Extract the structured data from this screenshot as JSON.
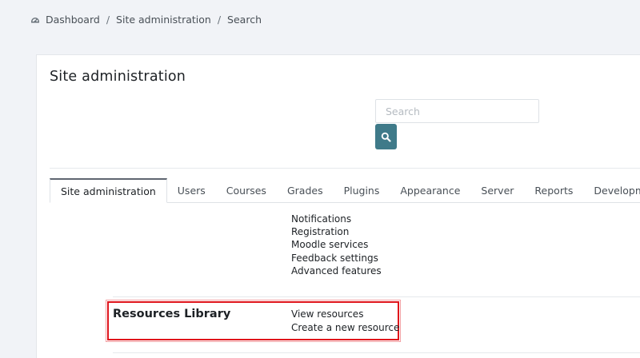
{
  "breadcrumb": {
    "items": [
      "Dashboard",
      "Site administration",
      "Search"
    ],
    "separator": "/"
  },
  "page": {
    "title": "Site administration"
  },
  "search": {
    "placeholder": "Search",
    "button_icon": "search-icon"
  },
  "tabs": [
    {
      "label": "Site administration",
      "active": true
    },
    {
      "label": "Users",
      "active": false
    },
    {
      "label": "Courses",
      "active": false
    },
    {
      "label": "Grades",
      "active": false
    },
    {
      "label": "Plugins",
      "active": false
    },
    {
      "label": "Appearance",
      "active": false
    },
    {
      "label": "Server",
      "active": false
    },
    {
      "label": "Reports",
      "active": false
    },
    {
      "label": "Development",
      "active": false
    }
  ],
  "general_links": [
    "Notifications",
    "Registration",
    "Moodle services",
    "Feedback settings",
    "Advanced features"
  ],
  "resources_section": {
    "heading": "Resources Library",
    "links": [
      "View resources",
      "Create a new resource"
    ]
  },
  "colors": {
    "accent": "#3f7a89",
    "highlight": "#e0141b",
    "background": "#f1f3f7"
  }
}
